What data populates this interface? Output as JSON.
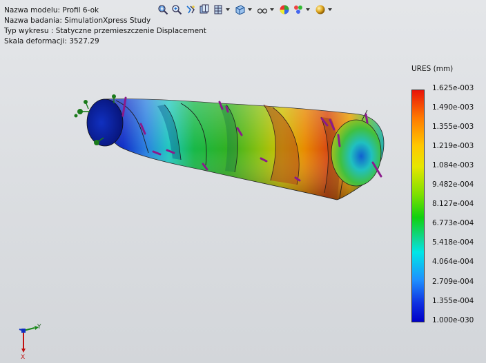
{
  "info": {
    "model_name": "Nazwa modelu: Profil 6-ok",
    "study_name": "Nazwa badania: SimulationXpress Study",
    "plot_type": "Typ wykresu : Statyczne przemieszczenie Displacement",
    "deformation_scale": "Skala deformacji: 3527.29"
  },
  "toolbar": {
    "items": [
      {
        "icon": "zoom-to-fit-icon"
      },
      {
        "icon": "zoom-to-area-icon"
      },
      {
        "icon": "previous-view-icon"
      },
      {
        "icon": "section-view-icon"
      },
      {
        "icon": "view-orientation-icon",
        "dropdown": true
      },
      {
        "icon": "display-style-icon",
        "dropdown": true
      },
      {
        "icon": "hide-show-items-icon",
        "dropdown": true
      },
      {
        "icon": "edit-appearance-icon"
      },
      {
        "icon": "apply-scene-icon",
        "dropdown": true
      },
      {
        "icon": "view-settings-icon",
        "dropdown": true
      }
    ]
  },
  "legend": {
    "title": "URES (mm)",
    "labels": [
      "1.625e-003",
      "1.490e-003",
      "1.355e-003",
      "1.219e-003",
      "1.084e-003",
      "9.482e-004",
      "8.127e-004",
      "6.773e-004",
      "5.418e-004",
      "4.064e-004",
      "2.709e-004",
      "1.355e-004",
      "1.000e-030"
    ]
  },
  "triad": {
    "x_label": "X",
    "y_label": "Y"
  },
  "colors": {
    "background_top": "#e4e6e9",
    "fixture_green": "#1a7a1a",
    "load_arrow_purple": "#8b1a8b",
    "max_red": "#e8140a",
    "min_blue": "#0000c8"
  }
}
